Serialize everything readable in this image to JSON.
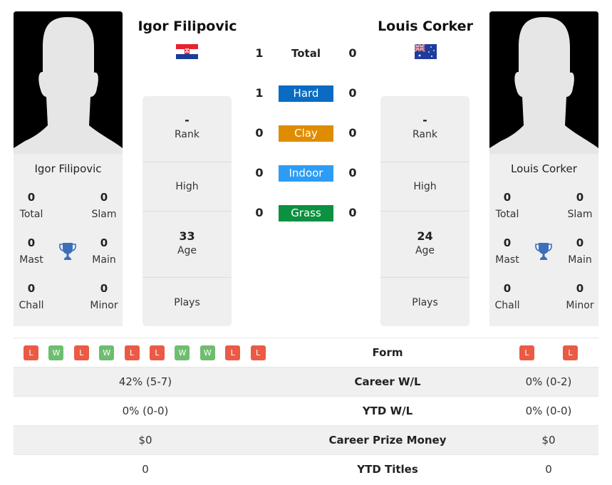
{
  "player1": {
    "name": "Igor Filipovic",
    "country": "Croatia",
    "flag_icon": "croatia-flag-icon",
    "titles": {
      "total": {
        "value": "0",
        "label": "Total"
      },
      "slam": {
        "value": "0",
        "label": "Slam"
      },
      "mast": {
        "value": "0",
        "label": "Mast"
      },
      "main": {
        "value": "0",
        "label": "Main"
      },
      "chall": {
        "value": "0",
        "label": "Chall"
      },
      "minor": {
        "value": "0",
        "label": "Minor"
      }
    },
    "rank": {
      "value": "-",
      "label": "Rank"
    },
    "high": {
      "value": "",
      "label": "High"
    },
    "age": {
      "value": "33",
      "label": "Age"
    },
    "plays": {
      "value": "",
      "label": "Plays"
    },
    "form": [
      "L",
      "W",
      "L",
      "W",
      "L",
      "L",
      "W",
      "W",
      "L",
      "L"
    ]
  },
  "player2": {
    "name": "Louis Corker",
    "country": "Australia",
    "flag_icon": "australia-flag-icon",
    "titles": {
      "total": {
        "value": "0",
        "label": "Total"
      },
      "slam": {
        "value": "0",
        "label": "Slam"
      },
      "mast": {
        "value": "0",
        "label": "Mast"
      },
      "main": {
        "value": "0",
        "label": "Main"
      },
      "chall": {
        "value": "0",
        "label": "Chall"
      },
      "minor": {
        "value": "0",
        "label": "Minor"
      }
    },
    "rank": {
      "value": "-",
      "label": "Rank"
    },
    "high": {
      "value": "",
      "label": "High"
    },
    "age": {
      "value": "24",
      "label": "Age"
    },
    "plays": {
      "value": "",
      "label": "Plays"
    },
    "form": [
      "L",
      "L"
    ]
  },
  "head_to_head": [
    {
      "label": "Total",
      "p1": "1",
      "p2": "0",
      "color": ""
    },
    {
      "label": "Hard",
      "p1": "1",
      "p2": "0",
      "color": "#0a6bc2"
    },
    {
      "label": "Clay",
      "p1": "0",
      "p2": "0",
      "color": "#e08c00"
    },
    {
      "label": "Indoor",
      "p1": "0",
      "p2": "0",
      "color": "#2d9cf5"
    },
    {
      "label": "Grass",
      "p1": "0",
      "p2": "0",
      "color": "#0b9140"
    }
  ],
  "stats": [
    {
      "label": "Form",
      "p1": "",
      "p2": ""
    },
    {
      "label": "Career W/L",
      "p1": "42% (5-7)",
      "p2": "0% (0-2)"
    },
    {
      "label": "YTD W/L",
      "p1": "0% (0-0)",
      "p2": "0% (0-0)"
    },
    {
      "label": "Career Prize Money",
      "p1": "$0",
      "p2": "$0"
    },
    {
      "label": "YTD Titles",
      "p1": "0",
      "p2": "0"
    }
  ],
  "colors": {
    "loss": "#ea5a45",
    "win": "#6fbd6f",
    "trophy": "#3d6fb8"
  }
}
